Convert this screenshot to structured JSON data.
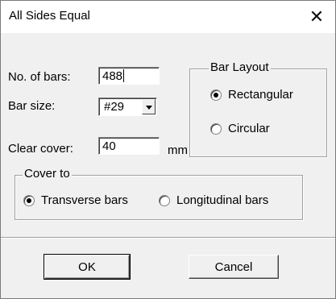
{
  "window": {
    "title": "All Sides Equal",
    "close_glyph": "✕"
  },
  "fields": {
    "no_of_bars_label": "No. of bars:",
    "no_of_bars_value": "488",
    "bar_size_label": "Bar size:",
    "bar_size_value": "#29",
    "clear_cover_label": "Clear cover:",
    "clear_cover_value": "40",
    "clear_cover_unit": "mm"
  },
  "bar_layout": {
    "title": "Bar Layout",
    "options": [
      {
        "label": "Rectangular",
        "checked": true
      },
      {
        "label": "Circular",
        "checked": false
      }
    ]
  },
  "cover_to": {
    "title": "Cover to",
    "options": [
      {
        "label": "Transverse bars",
        "checked": true
      },
      {
        "label": "Longitudinal bars",
        "checked": false
      }
    ]
  },
  "buttons": {
    "ok": "OK",
    "cancel": "Cancel"
  }
}
